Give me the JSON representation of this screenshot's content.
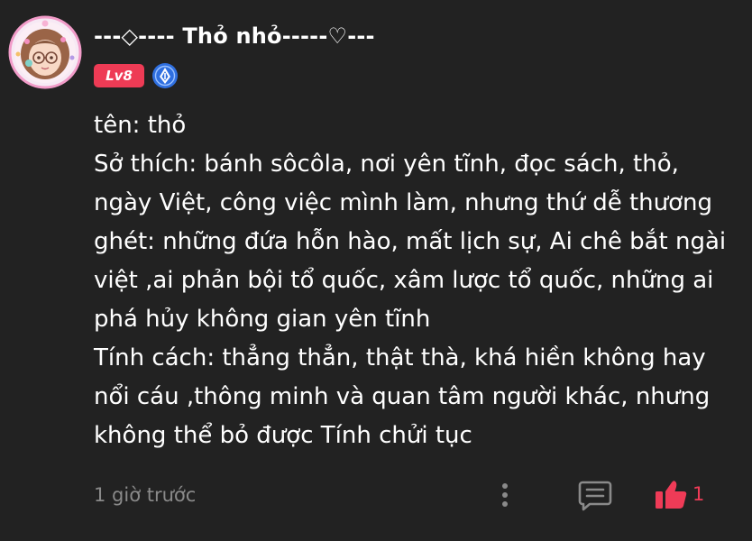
{
  "post": {
    "username": "---◇---- Thỏ nhỏ-----♡---",
    "level": "Lv8",
    "content_lines": [
      "tên: thỏ",
      "Sở thích: bánh sôcôla, nơi yên tĩnh, đọc sách, thỏ,",
      "ngày Việt, công việc mình làm, nhưng thứ dễ thương",
      "ghét: những đứa hỗn hào, mất lịch sự, Ai chê bắt ngài",
      "việt ,ai phản bội tổ quốc, xâm lược tổ quốc, những ai",
      "phá hủy không gian yên tĩnh",
      "Tính cách: thẳng thẳn, thật thà, khá hiền không hay",
      "nổi cáu ,thông minh và quan tâm người khác, nhưng",
      "không thể bỏ được Tính chửi tục"
    ],
    "timestamp": "1 giờ trước",
    "like_count": "1"
  },
  "icons": {
    "avatar": "avatar-anime-girl",
    "verify": "blue-verify-badge-icon",
    "more": "more-vertical-icon",
    "comment": "comment-icon",
    "like": "thumbs-up-icon"
  },
  "colors": {
    "background": "#222222",
    "text": "#ffffff",
    "muted": "#8a8a8a",
    "level_badge": "#ee3b55",
    "verify_badge": "#2f6fe0",
    "like": "#ef3b57",
    "icon_gray": "#8a8a8a"
  }
}
